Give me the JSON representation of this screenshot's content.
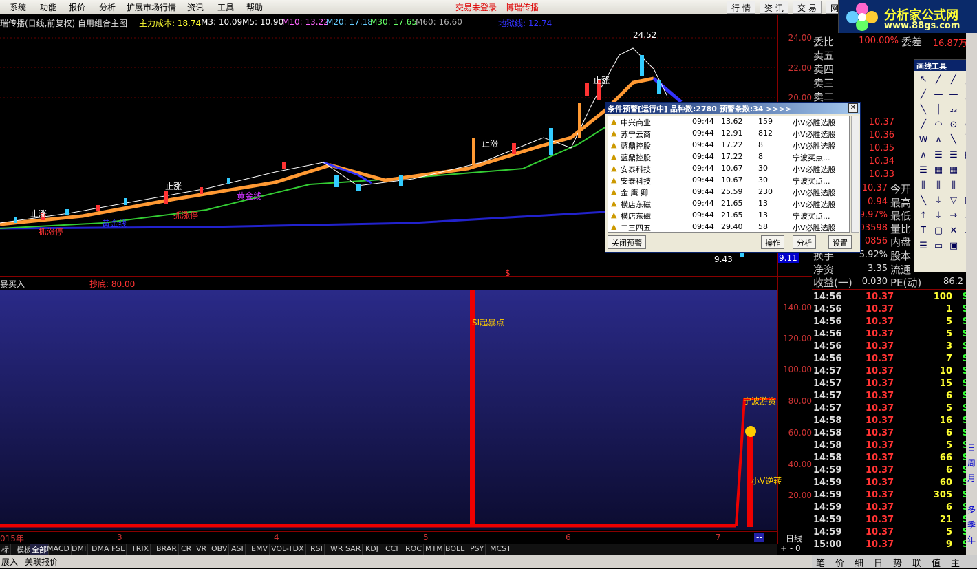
{
  "menu": {
    "items": [
      "系统",
      "功能",
      "报价",
      "分析",
      "扩展市场行情",
      "资讯",
      "工具",
      "帮助"
    ],
    "warning1": "交易未登录",
    "warning2": "博瑞传播",
    "buttons": [
      "行 情",
      "资 讯",
      "交 易",
      "网"
    ]
  },
  "logo": {
    "title": "分析家公式网",
    "url": "www.88gs.com"
  },
  "chart": {
    "title": "瑞传播(日线,前复权) 自用组合主图",
    "cost": "主力成本: 18.74",
    "m3": "M3: 10.09",
    "m5": "M5: 10.90",
    "m10": "M10: 13.22",
    "m20": "M20: 17.18",
    "m30": "M30: 17.65",
    "m60": "M60: 16.60",
    "danger": "地狱线: 12.74",
    "high": "24.52",
    "low": "9.43",
    "cur": "9.11",
    "yticks": [
      "24.00",
      "22.00",
      "20.00"
    ],
    "ann_zhizhang": "止涨",
    "ann_zhangting": "抓涨停",
    "ann_huangjin": "黄金线",
    "marker": "$"
  },
  "sub": {
    "title": "暴买入",
    "value": "抄底: 80.00",
    "yticks": [
      "140.00",
      "120.00",
      "100.00",
      "80.00",
      "60.00",
      "40.00",
      "20.00"
    ],
    "ann1": "SI起暴点",
    "ann2": "宁波游资",
    "ann3": "小V逆转"
  },
  "xaxis": {
    "labels": [
      "015年",
      "3",
      "4",
      "5",
      "6",
      "7"
    ],
    "period": "日线",
    "dash": "--"
  },
  "quote": {
    "labels": [
      "委比",
      "卖五",
      "卖四",
      "卖三",
      "卖二"
    ],
    "ratio": "100.00%",
    "diff_label": "委差",
    "diff": "16.87万",
    "prices": [
      "10.37",
      "10.36",
      "10.35",
      "10.34",
      "10.33"
    ],
    "rows": [
      {
        "v": "10.37",
        "l": "今开"
      },
      {
        "v": "0.94",
        "l": "最高"
      },
      {
        "v": "9.97%",
        "l": "最低"
      },
      {
        "v": "03598",
        "l": "量比"
      },
      {
        "v": "0856",
        "l": "内盘"
      }
    ],
    "labels2": [
      "换手",
      "净资",
      "收益(一)"
    ],
    "vals2": [
      "5.92%",
      "3.35",
      "0.030"
    ],
    "r2": [
      "股本",
      "流通",
      "PE(动)"
    ],
    "pe": "86.2"
  },
  "ticks": [
    {
      "t": "14:56",
      "p": "10.37",
      "v": "100",
      "s": "S"
    },
    {
      "t": "14:56",
      "p": "10.37",
      "v": "1",
      "s": "S"
    },
    {
      "t": "14:56",
      "p": "10.37",
      "v": "5",
      "s": "S"
    },
    {
      "t": "14:56",
      "p": "10.37",
      "v": "5",
      "s": "S"
    },
    {
      "t": "14:56",
      "p": "10.37",
      "v": "3",
      "s": "S"
    },
    {
      "t": "14:56",
      "p": "10.37",
      "v": "7",
      "s": "S"
    },
    {
      "t": "14:57",
      "p": "10.37",
      "v": "10",
      "s": "S"
    },
    {
      "t": "14:57",
      "p": "10.37",
      "v": "15",
      "s": "S"
    },
    {
      "t": "14:57",
      "p": "10.37",
      "v": "6",
      "s": "S"
    },
    {
      "t": "14:57",
      "p": "10.37",
      "v": "5",
      "s": "S"
    },
    {
      "t": "14:58",
      "p": "10.37",
      "v": "16",
      "s": "S"
    },
    {
      "t": "14:58",
      "p": "10.37",
      "v": "6",
      "s": "S"
    },
    {
      "t": "14:58",
      "p": "10.37",
      "v": "5",
      "s": "S"
    },
    {
      "t": "14:58",
      "p": "10.37",
      "v": "66",
      "s": "S"
    },
    {
      "t": "14:59",
      "p": "10.37",
      "v": "6",
      "s": "S"
    },
    {
      "t": "14:59",
      "p": "10.37",
      "v": "60",
      "s": "S"
    },
    {
      "t": "14:59",
      "p": "10.37",
      "v": "305",
      "s": "S"
    },
    {
      "t": "14:59",
      "p": "10.37",
      "v": "6",
      "s": "S"
    },
    {
      "t": "14:59",
      "p": "10.37",
      "v": "21",
      "s": "S"
    },
    {
      "t": "14:59",
      "p": "10.37",
      "v": "5",
      "s": "S"
    },
    {
      "t": "15:00",
      "p": "10.37",
      "v": "9",
      "s": "S"
    }
  ],
  "popup": {
    "title": "条件预警[运行中] 品种数:2780 预警条数:34 >>>>",
    "close": "关闭预警",
    "ops": "操作",
    "analyze": "分析",
    "settings": "设置",
    "rows": [
      {
        "n": "中兴商业",
        "t": "09:44",
        "p": "13.62",
        "c": "159",
        "s": "小V必胜选股"
      },
      {
        "n": "苏宁云商",
        "t": "09:44",
        "p": "12.91",
        "c": "812",
        "s": "小V必胜选股"
      },
      {
        "n": "蓝鼎控股",
        "t": "09:44",
        "p": "17.22",
        "c": "8",
        "s": "小V必胜选股"
      },
      {
        "n": "蓝鼎控股",
        "t": "09:44",
        "p": "17.22",
        "c": "8",
        "s": "宁波买点..."
      },
      {
        "n": "安泰科技",
        "t": "09:44",
        "p": "10.67",
        "c": "30",
        "s": "小V必胜选股"
      },
      {
        "n": "安泰科技",
        "t": "09:44",
        "p": "10.67",
        "c": "30",
        "s": "宁波买点..."
      },
      {
        "n": "金 鹰 卿",
        "t": "09:44",
        "p": "25.59",
        "c": "230",
        "s": "小V必胜选股"
      },
      {
        "n": "横店东磁",
        "t": "09:44",
        "p": "21.65",
        "c": "13",
        "s": "小V必胜选股"
      },
      {
        "n": "横店东磁",
        "t": "09:44",
        "p": "21.65",
        "c": "13",
        "s": "宁波买点..."
      },
      {
        "n": "二三四五",
        "t": "09:44",
        "p": "29.40",
        "c": "58",
        "s": "小V必胜选股"
      }
    ]
  },
  "tools": {
    "title": "画线工具"
  },
  "tabs": [
    "标",
    "模板",
    "全部",
    "MACD",
    "DMI",
    "DMA",
    "FSL",
    "TRIX",
    "BRAR",
    "CR",
    "VR",
    "OBV",
    "ASI",
    "EMV",
    "VOL-TDX",
    "RSI",
    "WR",
    "SAR",
    "KDJ",
    "CCI",
    "ROC",
    "MTM",
    "BOLL",
    "PSY",
    "MCST"
  ],
  "bottom": {
    "left": "展入",
    "assoc": "关联报价",
    "controls": "+ - 0"
  },
  "rtabs": [
    "笔",
    "价",
    "细",
    "日",
    "势",
    "联",
    "值",
    "主"
  ]
}
